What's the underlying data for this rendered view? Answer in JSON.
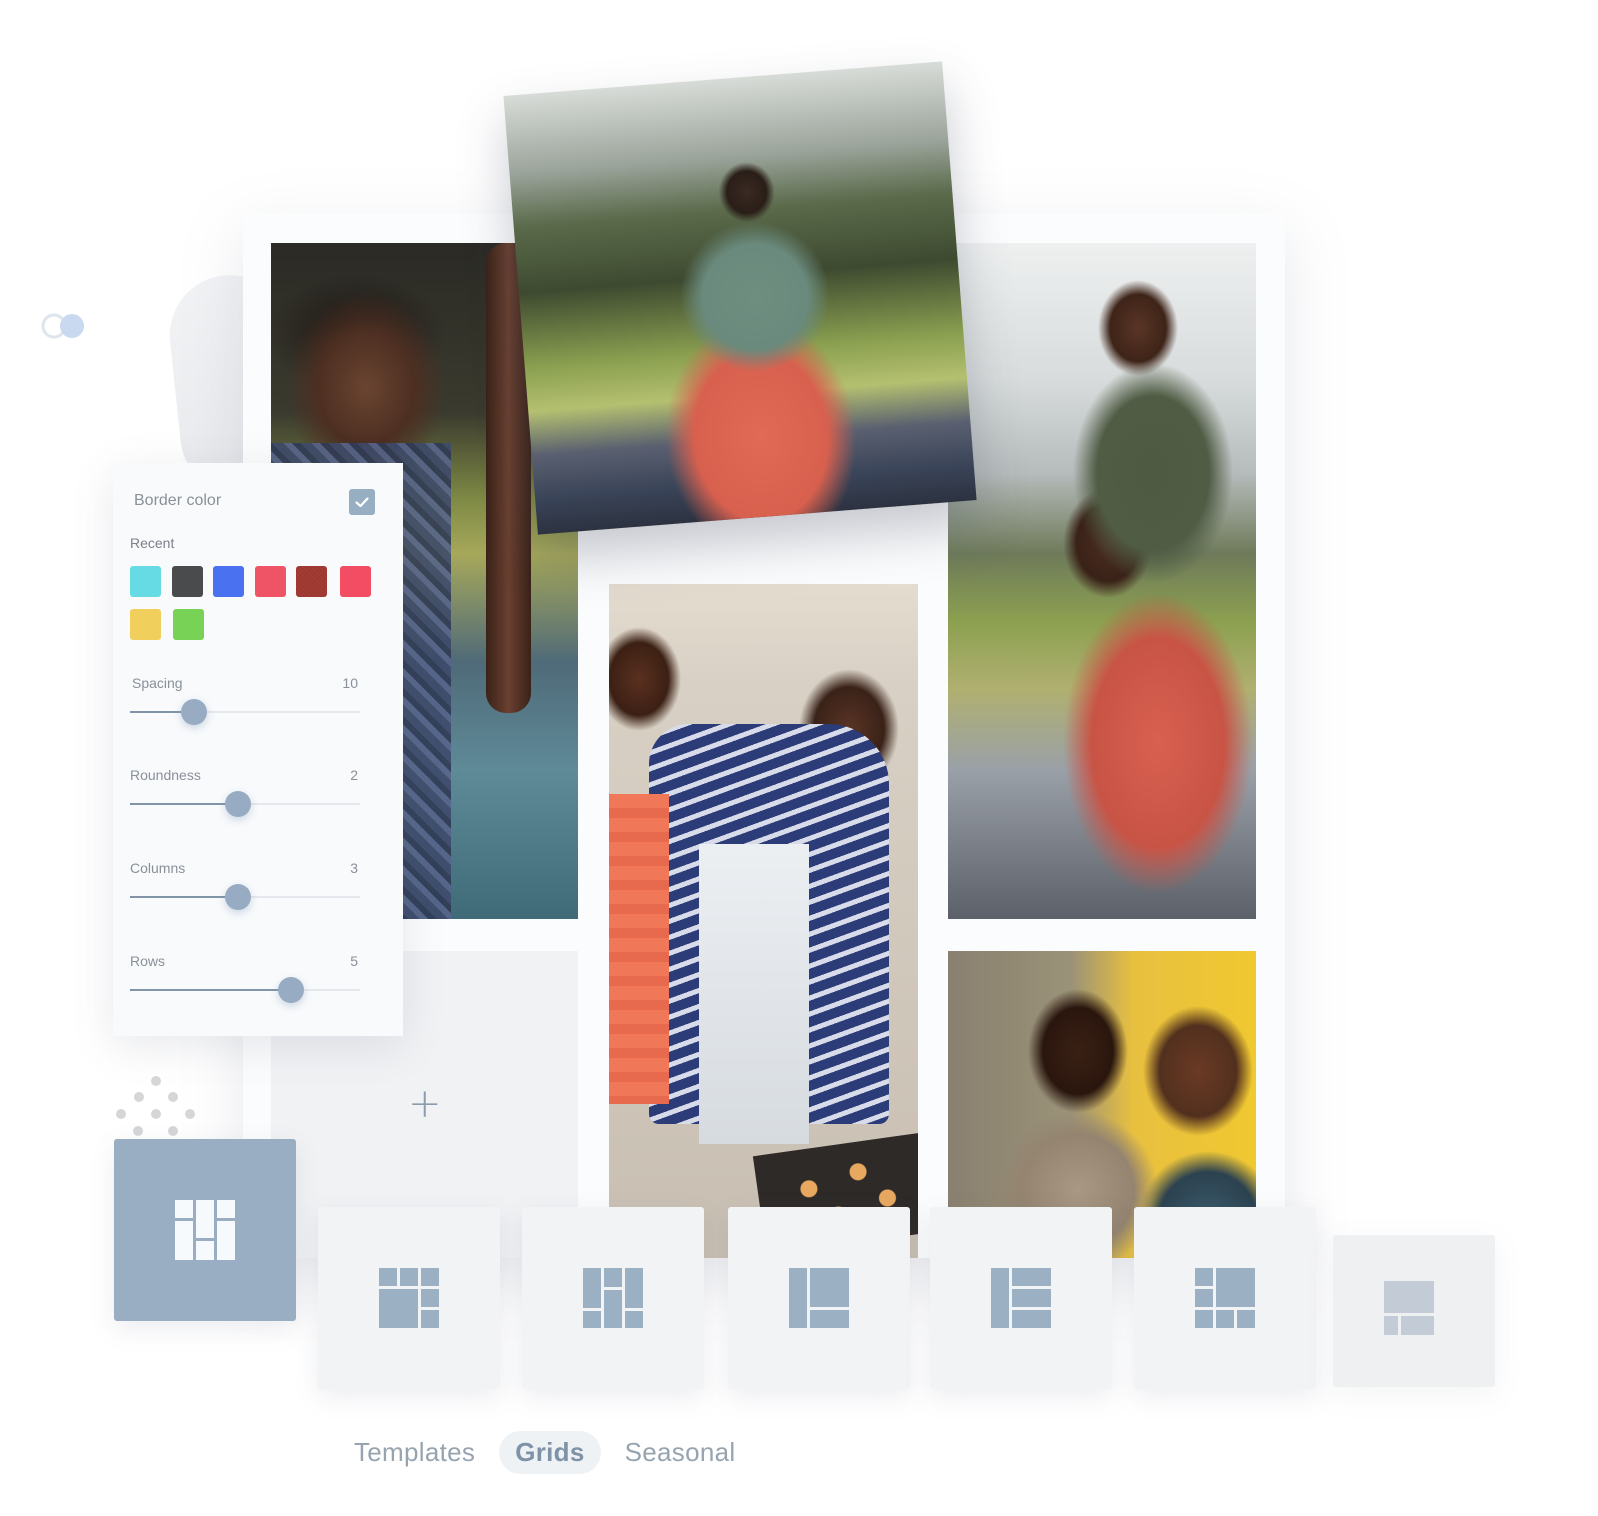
{
  "settings_panel": {
    "title": "Border color",
    "border_color_enabled": true,
    "recent_label": "Recent",
    "recent_colors": [
      "#66dbe4",
      "#4a4b4c",
      "#4a72f0",
      "#ef5466",
      "#a33c34",
      "#f24d62",
      "#f0cf5c",
      "#78d256"
    ],
    "sliders": [
      {
        "label": "Spacing",
        "value": "10",
        "fraction": 0.28
      },
      {
        "label": "Roundness",
        "value": "2",
        "fraction": 0.47
      },
      {
        "label": "Columns",
        "value": "3",
        "fraction": 0.47
      },
      {
        "label": "Rows",
        "value": "5",
        "fraction": 0.7
      }
    ]
  },
  "canvas": {
    "photos": [
      {
        "name": "photo-boy-smiling"
      },
      {
        "name": "photo-father-son-shoulders-back"
      },
      {
        "name": "photo-father-son-shoulders-front"
      },
      {
        "name": "photo-baking-cookies"
      },
      {
        "name": "photo-father-son-picnic"
      }
    ],
    "empty_cell_icon": "plus-icon",
    "plus_glyph": "+"
  },
  "layout_tiles": [
    {
      "name": "grid-layout-1",
      "selected": true
    },
    {
      "name": "grid-layout-2",
      "selected": false
    },
    {
      "name": "grid-layout-3",
      "selected": false
    },
    {
      "name": "grid-layout-4",
      "selected": false
    },
    {
      "name": "grid-layout-5",
      "selected": false
    },
    {
      "name": "grid-layout-6",
      "selected": false
    },
    {
      "name": "grid-layout-7",
      "selected": false
    }
  ],
  "tabs": [
    {
      "label": "Templates",
      "active": false
    },
    {
      "label": "Grids",
      "active": true
    },
    {
      "label": "Seasonal",
      "active": false
    }
  ],
  "colors": {
    "accent": "#98aec3",
    "tile_bg": "#f1f3f5",
    "text_muted": "#8a9098"
  }
}
